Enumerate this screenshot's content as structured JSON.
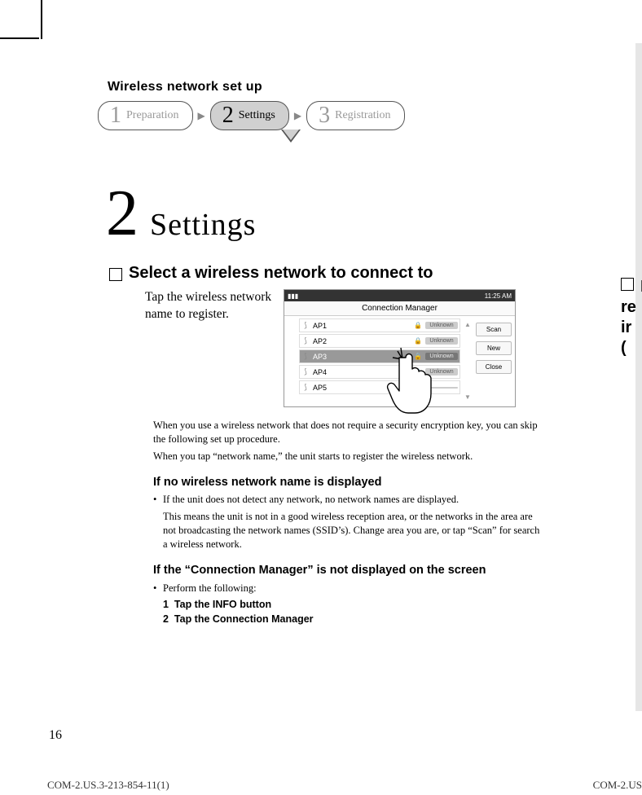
{
  "header": {
    "crumb_title": "Wireless network set up",
    "steps": [
      {
        "num": "1",
        "label": "Preparation"
      },
      {
        "num": "2",
        "label": "Settings"
      },
      {
        "num": "3",
        "label": "Registration"
      }
    ]
  },
  "title": {
    "num": "2",
    "text": "Settings"
  },
  "section1": {
    "heading": "Select a wireless network to connect to",
    "body": "Tap the wireless network name to register."
  },
  "mock": {
    "time": "11:25 AM",
    "title": "Connection Manager",
    "aps": [
      {
        "name": "AP1",
        "tag": "Unknown"
      },
      {
        "name": "AP2",
        "tag": "Unknown"
      },
      {
        "name": "AP3",
        "tag": "Unknown"
      },
      {
        "name": "AP4",
        "tag": "Unknown"
      },
      {
        "name": "AP5",
        "tag": ""
      }
    ],
    "buttons": {
      "scan": "Scan",
      "new": "New",
      "close": "Close"
    }
  },
  "notes": {
    "n1": "When you use a wireless network that does not require a security encryption key, you can skip the following set up procedure.",
    "n2": "When you tap “network name,” the unit starts to register the wireless network."
  },
  "sub1": {
    "heading": "If no wireless network name is displayed",
    "bullet1": "If the unit does not detect any network, no network names are displayed.",
    "bullet1b": "This means the unit is not in a good wireless reception area, or the networks in the area are not broadcasting the network names (SSID’s). Change area you are, or tap “Scan” for search a wireless network."
  },
  "sub2": {
    "heading": "If the “Connection Manager” is not displayed on the screen",
    "bullet1": "Perform the following:",
    "steps": [
      {
        "n": "1",
        "t": "Tap the INFO button"
      },
      {
        "n": "2",
        "t": "Tap the Connection Manager"
      }
    ]
  },
  "truncated": {
    "l1": "E",
    "l2": "re",
    "l3": "ir",
    "l4": "("
  },
  "page_number": "16",
  "footer_left": "COM-2.US.3-213-854-11(1)",
  "footer_right": "COM-2.US"
}
